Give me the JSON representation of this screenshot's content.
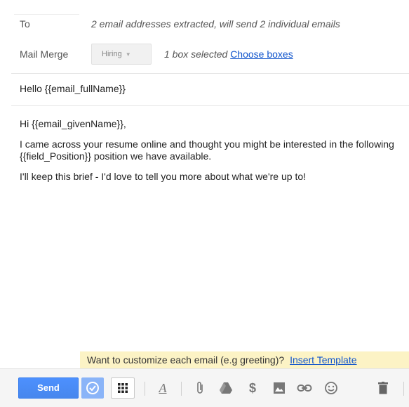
{
  "to": {
    "label": "To",
    "summary": "2 email addresses extracted, will send 2 individual emails"
  },
  "mail_merge": {
    "label": "Mail Merge",
    "select_value": "Hiring",
    "boxes_selected": "1 box selected",
    "choose_boxes_link": "Choose boxes"
  },
  "subject": "Hello {{email_fullName}}",
  "body": {
    "greeting": "Hi {{email_givenName}},",
    "paragraph1": "I came across your resume online and thought you might be interested in the following {{field_Position}} position we have available.",
    "paragraph2": "I'll keep this brief - I'd love to tell you more about what we're up to!"
  },
  "banner": {
    "text": "Want to customize each email (e.g greeting)?",
    "link": "Insert Template"
  },
  "toolbar": {
    "send_label": "Send",
    "format_glyph": "A",
    "money_glyph": "$",
    "accent_color": "#4d90fe"
  }
}
